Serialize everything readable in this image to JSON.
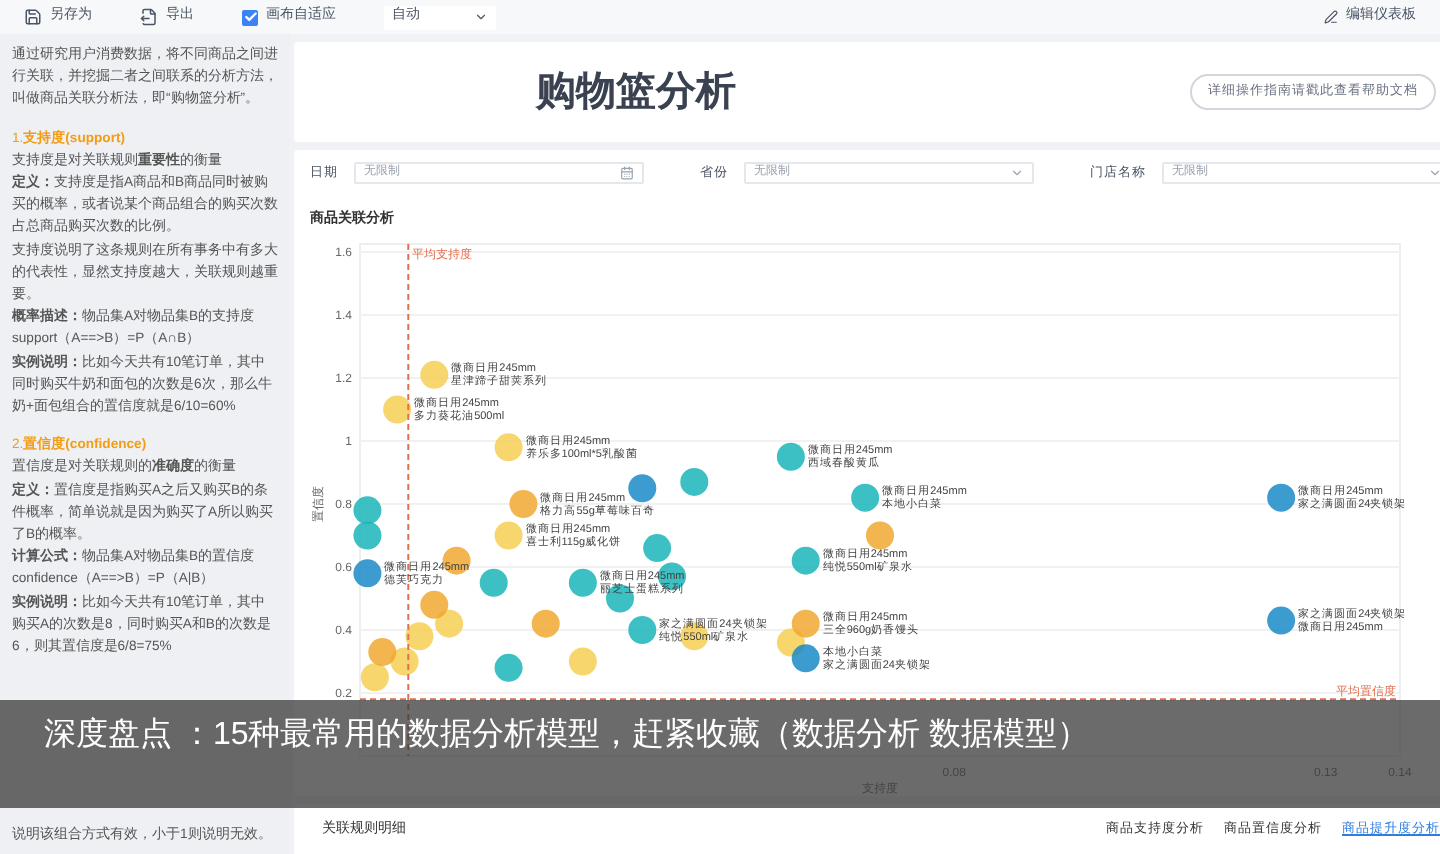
{
  "toolbar": {
    "items": [
      {
        "kind": "button",
        "label": "另存为"
      },
      {
        "kind": "button",
        "label": "导出"
      },
      {
        "kind": "checkbox",
        "label": "画布自适应",
        "checked": true
      },
      {
        "kind": "select",
        "label": "自动"
      }
    ],
    "edit_link": "编辑仪表板"
  },
  "sidebar": {
    "intro": "通过研究用户消费数据，将不同商品之间进行关联，并挖掘二者之间联系的分析方法，叫做商品关联分析法，即“购物篮分析”。",
    "sections": [
      {
        "heading": "1.**支持度(support)**",
        "paragraphs": [
          "支持度是对关联规则**重要性**的衡量",
          "**定义：**支持度是指A商品和B商品同时被购买的概率，或者说某个商品组合的购买次数占总商品购买次数的比例。",
          "支持度说明了这条规则在所有事务中有多大的代表性，显然支持度越大，关联规则越重要。",
          "**概率描述：**物品集A对物品集B的支持度support（A==>B）=P（A∩B）",
          "**实例说明：**比如今天共有10笔订单，其中同时购买牛奶和面包的次数是6次，那么牛奶+面包组合的置信度就是6/10=60%"
        ]
      },
      {
        "heading": "2.**置信度(confidence)**",
        "paragraphs": [
          "置信度是对关联规则的**准确度**的衡量",
          "**定义：**置信度是指购买A之后又购买B的条件概率，简单说就是因为购买了A所以购买了B的概率。",
          "**计算公式：**物品集A对物品集B的置信度confidence（A==>B）=P（A|B）",
          "**实例说明：**比如今天共有10笔订单，其中购买A的次数是8，同时购买A和B的次数是6，则其置信度是6/8=75%"
        ]
      }
    ],
    "tail": "说明该组合方式有效，小于1则说明无效。"
  },
  "header": {
    "title": "购物篮分析",
    "help_button": "详细操作指南请戳此查看帮助文档"
  },
  "filters": [
    {
      "kind": "date",
      "label": "日期",
      "placeholder": "无限制"
    },
    {
      "kind": "select",
      "label": "省份",
      "placeholder": "无限制"
    },
    {
      "kind": "select",
      "label": "门店名称",
      "placeholder": "无限制"
    }
  ],
  "chart_panel": {
    "title": "商品关联分析",
    "chart_data": {
      "type": "scatter",
      "xlabel": "支持度",
      "ylabel": "置信度",
      "xlim": [
        0,
        0.14
      ],
      "ylim": [
        0,
        1.6
      ],
      "xticks": [
        0.08,
        0.13,
        0.14
      ],
      "yticks": [
        0.2,
        0.4,
        0.6,
        0.8,
        1,
        1.2,
        1.4,
        1.6
      ],
      "ref_lines": [
        {
          "axis": "x",
          "value": 0.0065,
          "label": "平均支持度"
        },
        {
          "axis": "y",
          "value": 0.18,
          "label": "平均置信度"
        }
      ],
      "grid": true,
      "series": [
        {
          "color": "#f7cf55",
          "x": [
            0.01,
            0.005,
            0.02,
            0.012,
            0.008,
            0.045,
            0.058,
            0.006,
            0.03,
            0.002,
            0.02
          ],
          "values": [
            1.21,
            1.1,
            0.98,
            0.42,
            0.38,
            0.38,
            0.36,
            0.3,
            0.3,
            0.25,
            0.7
          ]
        },
        {
          "color": "#f0a830",
          "x": [
            0.013,
            0.07,
            0.01,
            0.025,
            0.003,
            0.06,
            0.022
          ],
          "values": [
            0.62,
            0.7,
            0.48,
            0.42,
            0.33,
            0.42,
            0.8
          ]
        },
        {
          "color": "#1bb5b8",
          "x": [
            0.001,
            0.001,
            0.058,
            0.045,
            0.068,
            0.04,
            0.042,
            0.035,
            0.06,
            0.018,
            0.03,
            0.02,
            0.038
          ],
          "values": [
            0.78,
            0.7,
            0.95,
            0.87,
            0.82,
            0.66,
            0.57,
            0.5,
            0.62,
            0.55,
            0.55,
            0.28,
            0.4
          ]
        },
        {
          "color": "#1a8ac7",
          "x": [
            0.038,
            0.124,
            0.124,
            0.06,
            0.001
          ],
          "values": [
            0.85,
            0.82,
            0.43,
            0.31,
            0.58
          ]
        }
      ],
      "annotations": [
        {
          "x": 0.01,
          "y": 1.21,
          "text": "微商日用245mm"
        },
        {
          "x": 0.01,
          "y": 1.21,
          "text": "星津蹄子甜荚系列"
        },
        {
          "x": 0.005,
          "y": 1.1,
          "text": "微商日用245mm"
        },
        {
          "x": 0.005,
          "y": 1.1,
          "text": "多力葵花油500ml"
        },
        {
          "x": 0.02,
          "y": 0.98,
          "text": "微商日用245mm"
        },
        {
          "x": 0.02,
          "y": 0.98,
          "text": "养乐多100ml*5乳酸菌"
        },
        {
          "x": 0.058,
          "y": 0.95,
          "text": "微商日用245mm"
        },
        {
          "x": 0.058,
          "y": 0.95,
          "text": "西域春酸黄瓜"
        },
        {
          "x": 0.068,
          "y": 0.82,
          "text": "微商日用245mm"
        },
        {
          "x": 0.068,
          "y": 0.82,
          "text": "本地小白菜"
        },
        {
          "x": 0.124,
          "y": 0.82,
          "text": "微商日用245mm"
        },
        {
          "x": 0.124,
          "y": 0.82,
          "text": "家之满圆面24夹锁架"
        },
        {
          "x": 0.022,
          "y": 0.8,
          "text": "微商日用245mm"
        },
        {
          "x": 0.022,
          "y": 0.8,
          "text": "格力高55g草莓味百奇"
        },
        {
          "x": 0.02,
          "y": 0.7,
          "text": "微商日用245mm"
        },
        {
          "x": 0.02,
          "y": 0.7,
          "text": "喜士利115g威化饼"
        },
        {
          "x": 0.06,
          "y": 0.62,
          "text": "微商日用245mm"
        },
        {
          "x": 0.06,
          "y": 0.62,
          "text": "纯悦550ml矿泉水"
        },
        {
          "x": 0.001,
          "y": 0.58,
          "text": "微商日用245mm"
        },
        {
          "x": 0.001,
          "y": 0.58,
          "text": "德芙巧克力"
        },
        {
          "x": 0.03,
          "y": 0.55,
          "text": "微商日用245mm"
        },
        {
          "x": 0.03,
          "y": 0.55,
          "text": "丽芝士蛋糕系列"
        },
        {
          "x": 0.06,
          "y": 0.42,
          "text": "微商日用245mm"
        },
        {
          "x": 0.06,
          "y": 0.42,
          "text": "三全960g奶香馒头"
        },
        {
          "x": 0.124,
          "y": 0.43,
          "text": "家之满圆面24夹锁架"
        },
        {
          "x": 0.124,
          "y": 0.43,
          "text": "微商日用245mm"
        },
        {
          "x": 0.038,
          "y": 0.4,
          "text": "家之满圆面24夹锁架"
        },
        {
          "x": 0.038,
          "y": 0.4,
          "text": "纯悦550ml矿泉水"
        },
        {
          "x": 0.06,
          "y": 0.31,
          "text": "本地小白菜"
        },
        {
          "x": 0.06,
          "y": 0.31,
          "text": "家之满圆面24夹锁架"
        }
      ]
    }
  },
  "details": {
    "title": "关联规则明细",
    "tabs": [
      {
        "label": "商品支持度分析",
        "selected": false
      },
      {
        "label": "商品置信度分析",
        "selected": false
      },
      {
        "label": "商品提升度分析",
        "selected": true
      }
    ]
  },
  "caption": "深度盘点 ：15种最常用的数据分析模型，赶紧收藏（数据分析 数据模型）"
}
